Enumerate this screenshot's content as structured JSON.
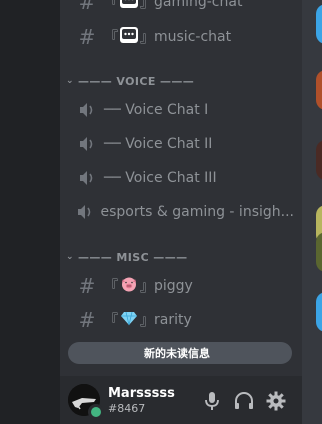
{
  "channels_top": [
    {
      "prefix": "『",
      "emoji": "speech-balloon",
      "suffix": "』",
      "name": "gaming-chat"
    },
    {
      "prefix": "『",
      "emoji": "speech-balloon",
      "suffix": "』",
      "name": "music-chat"
    }
  ],
  "voice_category": {
    "label": "——— VOICE ———"
  },
  "voice_channels": [
    {
      "name": "── Voice Chat I"
    },
    {
      "name": "── Voice Chat II"
    },
    {
      "name": "── Voice Chat III"
    },
    {
      "name": "esports & gaming - insigh..."
    }
  ],
  "misc_category": {
    "label": "——— MISC ———"
  },
  "misc_channels": [
    {
      "prefix": "『",
      "emoji": "pig-face",
      "suffix": "』",
      "name": "piggy"
    },
    {
      "prefix": "『",
      "emoji": "gem-stone",
      "suffix": "』",
      "name": "rarity"
    }
  ],
  "unread_banner": {
    "label": "新的未读信息"
  },
  "user": {
    "name": "Marsssss",
    "discriminator": "#8467",
    "status_color": "#43b581"
  },
  "colors": {
    "accent_status": "#43b581",
    "channel_text": "#8e9297",
    "panel_bg": "#2f3136"
  }
}
